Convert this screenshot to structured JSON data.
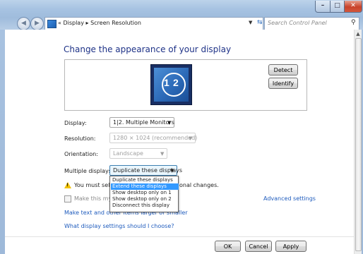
{
  "window": {
    "address": {
      "prefix": "«",
      "path": [
        "Display",
        "Screen Resolution"
      ],
      "separator": "▸"
    },
    "search_placeholder": "Search Control Panel"
  },
  "icons": [
    "back-arrow-icon",
    "forward-arrow-icon",
    "control-panel-icon",
    "dropdown-arrow-icon",
    "refresh-icon",
    "search-icon",
    "minimize-icon",
    "maximize-icon",
    "close-icon",
    "warning-icon"
  ],
  "main": {
    "heading": "Change the appearance of your display",
    "monitor_label_1": "1",
    "monitor_label_2": "2",
    "detect_label": "Detect",
    "identify_label": "Identify",
    "display_label": "Display:",
    "display_value": "1|2. Multiple Monitors",
    "resolution_label": "Resolution:",
    "resolution_value": "1280 × 1024 (recommended)",
    "orientation_label": "Orientation:",
    "orientation_value": "Landscape",
    "multiple_label": "Multiple displays:",
    "multiple_value": "Duplicate these displays",
    "multiple_options": [
      "Duplicate these displays",
      "Extend these displays",
      "Show desktop only on 1",
      "Show desktop only on 2",
      "Disconnect this display"
    ],
    "multiple_selected_option": "Extend these displays",
    "warning_prefix": "You must selec",
    "warning_suffix": "onal changes.",
    "checkbox_label": "Make this my m",
    "advanced_link": "Advanced settings",
    "link_text_prefix": "Make text and other",
    "link_text_hidden": " items larger or smaller",
    "link_help": "What display settings should I choose?"
  },
  "footer": {
    "ok_label": "OK",
    "cancel_label": "Cancel",
    "apply_label": "Apply"
  }
}
